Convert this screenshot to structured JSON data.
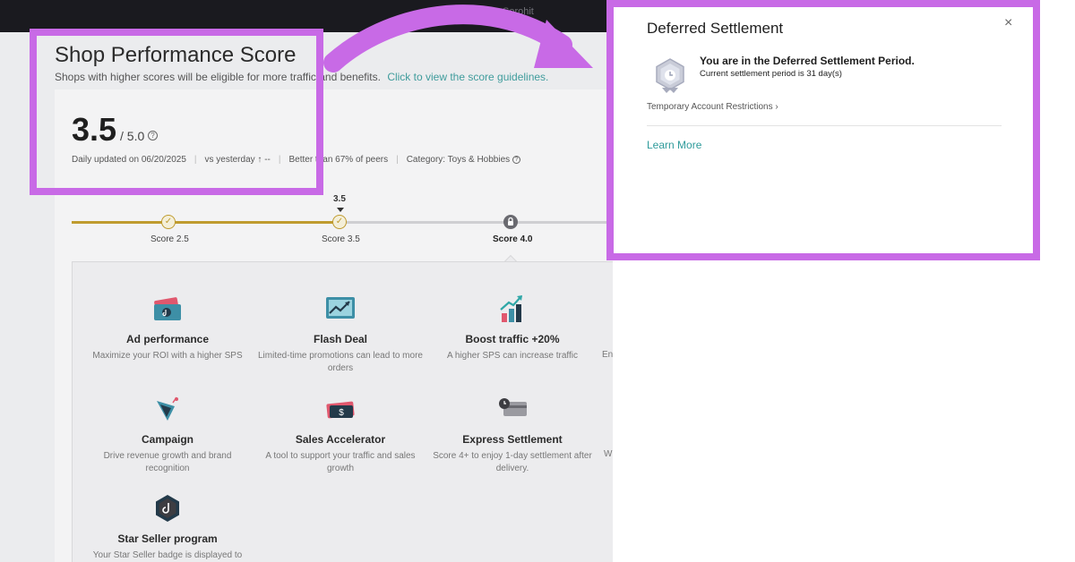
{
  "topbar": {
    "user": "Sorohit"
  },
  "header": {
    "title": "Shop Performance Score",
    "subtitle": "Shops with higher scores will be eligible for more traffic and benefits.",
    "guide_link": "Click to view the score guidelines."
  },
  "score": {
    "value": "3.5",
    "max": "/ 5.0",
    "updated": "Daily updated on 06/20/2025",
    "vs_yesterday": "vs yesterday ↑ --",
    "peers": "Better than 67% of peers",
    "category": "Category: Toys & Hobbies"
  },
  "progress": {
    "current_marker": "3.5",
    "steps": [
      {
        "label": "Score 2.5",
        "state": "done"
      },
      {
        "label": "Score 3.5",
        "state": "done"
      },
      {
        "label": "Score 4.0",
        "state": "locked"
      }
    ]
  },
  "benefits": [
    {
      "icon": "ad-performance-icon",
      "title": "Ad performance",
      "desc": "Maximize your ROI with a higher SPS"
    },
    {
      "icon": "flash-deal-icon",
      "title": "Flash Deal",
      "desc": "Limited-time promotions can lead to more orders"
    },
    {
      "icon": "boost-traffic-icon",
      "title": "Boost traffic +20%",
      "desc": "A higher SPS can increase traffic"
    },
    {
      "icon": "campaign-icon",
      "title": "Campaign",
      "desc": "Drive revenue growth and brand recognition"
    },
    {
      "icon": "sales-accelerator-icon",
      "title": "Sales Accelerator",
      "desc": "A tool to support your traffic and sales growth"
    },
    {
      "icon": "express-settlement-icon",
      "title": "Express Settlement",
      "desc": "Score 4+ to enjoy 1-day settlement after delivery."
    },
    {
      "icon": "star-seller-icon",
      "title": "Star Seller program",
      "desc": "Your Star Seller badge is displayed to"
    }
  ],
  "benefits_partial": [
    "En",
    "W"
  ],
  "modal": {
    "title": "Deferred Settlement",
    "close": "×",
    "heading": "You are in the Deferred Settlement Period.",
    "sub": "Current settlement period is 31 day(s)",
    "restrictions_link": "Temporary Account Restrictions ›",
    "learn_more": "Learn More"
  },
  "colors": {
    "highlight": "#c86ae6",
    "accent_teal": "#3f9c9c",
    "progress_gold": "#bf9b2f"
  }
}
